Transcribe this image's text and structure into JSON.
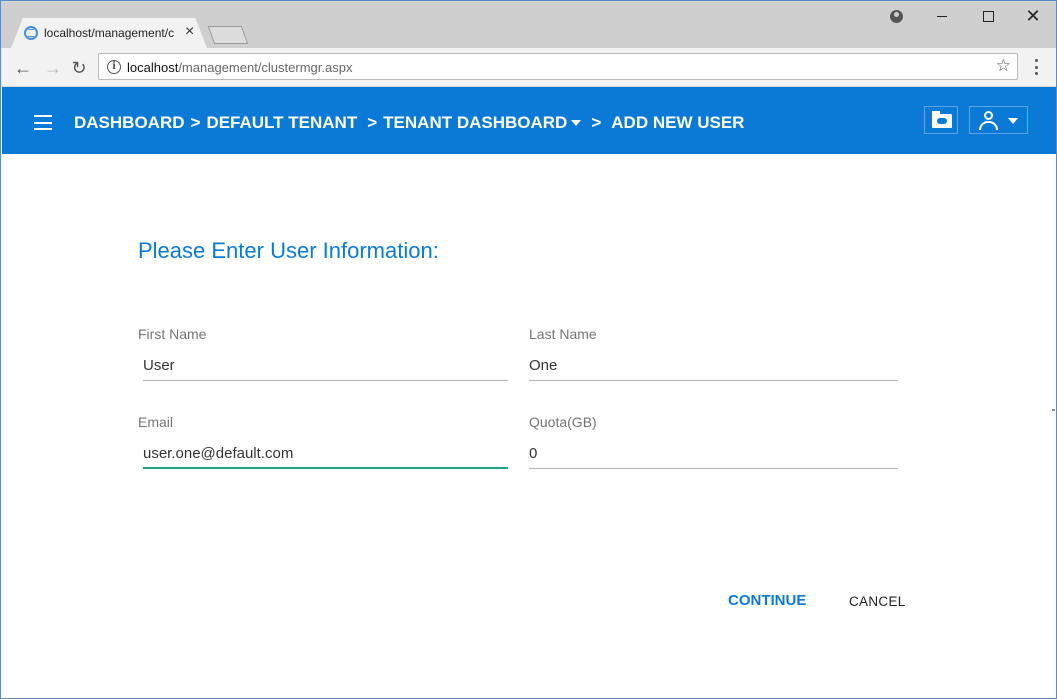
{
  "browser": {
    "tab_title": "localhost/management/c",
    "tab_close": "×",
    "url_host": "localhost",
    "url_path": "/management/clustermgr.aspx",
    "window_close": "✕",
    "icons": [
      "favicon-icon",
      "profile-icon",
      "minimize-icon",
      "maximize-icon",
      "close-icon",
      "back-icon",
      "forward-icon",
      "reload-icon",
      "info-icon",
      "star-icon",
      "menu-icon"
    ]
  },
  "header": {
    "breadcrumb": [
      {
        "label": "DASHBOARD"
      },
      {
        "label": "DEFAULT TENANT"
      },
      {
        "label": "TENANT DASHBOARD"
      },
      {
        "label": "ADD NEW USER"
      }
    ],
    "separator": ">",
    "accent_color": "#0a7ad6",
    "icons": [
      "hamburger-icon",
      "folder-cloud-icon",
      "user-icon"
    ]
  },
  "form": {
    "title": "Please Enter User Information:",
    "first_name": {
      "label": "First Name",
      "value": "User"
    },
    "last_name": {
      "label": "Last Name",
      "value": "One"
    },
    "email": {
      "label": "Email",
      "value": "user.one@default.com"
    },
    "quota": {
      "label": "Quota(GB)",
      "value": "0"
    },
    "continue_label": "CONTINUE",
    "cancel_label": "CANCEL",
    "focus_color": "#1aa384"
  }
}
